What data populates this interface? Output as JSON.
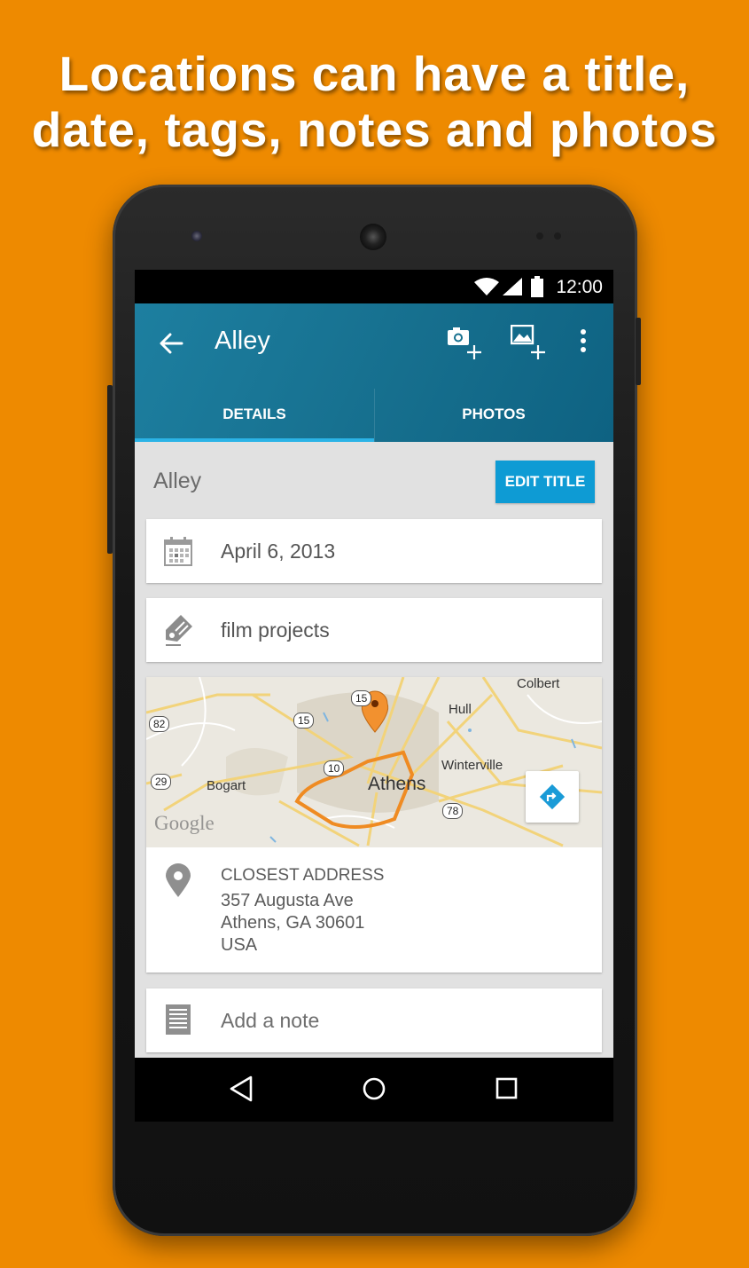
{
  "headline": {
    "line1": "Locations can have a title,",
    "line2": "date, tags, notes and photos"
  },
  "status_bar": {
    "time": "12:00",
    "icons": [
      "wifi-icon",
      "signal-icon",
      "battery-icon"
    ]
  },
  "app_bar": {
    "title": "Alley",
    "actions": [
      "add-camera-photo-icon",
      "add-gallery-photo-icon",
      "overflow-menu-icon"
    ]
  },
  "tabs": [
    {
      "label": "DETAILS",
      "active": true
    },
    {
      "label": "PHOTOS",
      "active": false
    }
  ],
  "details": {
    "location_title": "Alley",
    "edit_title_label": "EDIT TITLE",
    "date": "April 6, 2013",
    "tags": "film projects",
    "map": {
      "city": "Athens",
      "places": [
        "Colbert",
        "Hull",
        "Winterville",
        "Bogart"
      ],
      "route_shields": [
        "15",
        "82",
        "15",
        "10",
        "29",
        "78"
      ],
      "attribution": "Google"
    },
    "address": {
      "heading": "CLOSEST ADDRESS",
      "line1": "357 Augusta Ave",
      "line2": "Athens, GA 30601",
      "line3": "USA"
    },
    "note_placeholder": "Add a note"
  },
  "colors": {
    "background": "#EE8A00",
    "app_bar": "#166F8E",
    "accent": "#0E9BD4",
    "tab_indicator": "#2BB3E6"
  }
}
